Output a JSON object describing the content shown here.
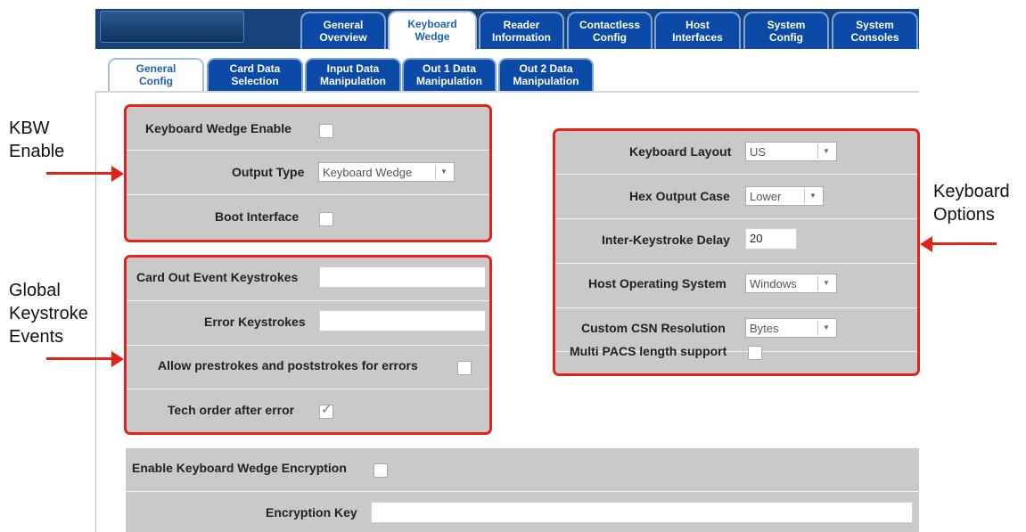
{
  "main_tabs": [
    {
      "line1": "General",
      "line2": "Overview"
    },
    {
      "line1": "Keyboard",
      "line2": "Wedge"
    },
    {
      "line1": "Reader",
      "line2": "Information"
    },
    {
      "line1": "Contactless",
      "line2": "Config"
    },
    {
      "line1": "Host",
      "line2": "Interfaces"
    },
    {
      "line1": "System",
      "line2": "Config"
    },
    {
      "line1": "System",
      "line2": "Consoles"
    }
  ],
  "sub_tabs": [
    {
      "line1": "General",
      "line2": "Config"
    },
    {
      "line1": "Card Data",
      "line2": "Selection"
    },
    {
      "line1": "Input Data",
      "line2": "Manipulation"
    },
    {
      "line1": "Out 1 Data",
      "line2": "Manipulation"
    },
    {
      "line1": "Out 2 Data",
      "line2": "Manipulation"
    }
  ],
  "kbw_panel": {
    "enable_label": "Keyboard Wedge Enable",
    "output_type_label": "Output Type",
    "output_type_value": "Keyboard Wedge",
    "boot_interface_label": "Boot Interface"
  },
  "events_panel": {
    "card_out_label": "Card Out Event Keystrokes",
    "card_out_value": "",
    "error_label": "Error Keystrokes",
    "error_value": "",
    "allow_label": "Allow prestrokes and poststrokes for errors",
    "tech_order_label": "Tech order after error"
  },
  "options_panel": {
    "layout_label": "Keyboard Layout",
    "layout_value": "US",
    "hex_label": "Hex Output Case",
    "hex_value": "Lower",
    "delay_label": "Inter-Keystroke Delay",
    "delay_value": "20",
    "os_label": "Host Operating System",
    "os_value": "Windows",
    "csn_label": "Custom CSN Resolution",
    "csn_value": "Bytes",
    "pacs_label": "Multi PACS length support"
  },
  "encryption_panel": {
    "enable_label": "Enable Keyboard Wedge Encryption",
    "key_label": "Encryption Key",
    "key_value": ""
  },
  "annotations": {
    "kbw_line1": "KBW",
    "kbw_line2": "Enable",
    "global_line1": "Global",
    "global_line2": "Keystroke",
    "global_line3": "Events",
    "kbopt_line1": "Keyboard",
    "kbopt_line2": "Options"
  },
  "colors": {
    "tab_blue": "#0c4aa8",
    "highlight_red": "#e2231a",
    "panel_gray": "#c9c9c9"
  },
  "icons": {
    "dropdown": "chevron-down-icon",
    "checked": "checkmark-icon",
    "arrow": "arrow-icon"
  }
}
